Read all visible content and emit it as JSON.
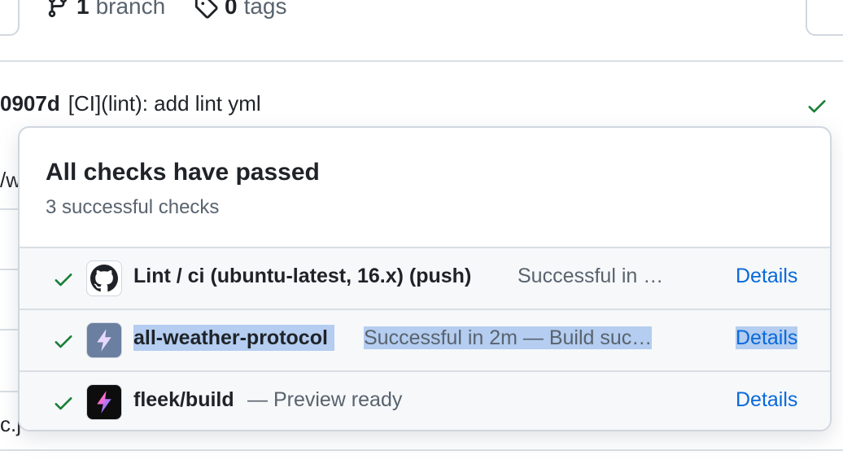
{
  "repo_meta": {
    "branch_count": "1",
    "branch_label": "branch",
    "tag_count": "0",
    "tag_label": "tags"
  },
  "commit": {
    "sha": "0907d",
    "message": "[CI](lint): add lint yml"
  },
  "background_fragments": [
    "/w",
    "c.j"
  ],
  "popover": {
    "title": "All checks have passed",
    "subtitle": "3 successful checks",
    "checks": [
      {
        "name": "Lint / ci (ubuntu-latest, 16.x) (push)",
        "status": "Successful in …",
        "details": "Details",
        "icon": "github-icon"
      },
      {
        "name": "all-weather-protocol",
        "status": "Successful in 2m — Build suc…",
        "details": "Details",
        "icon": "lightning-icon"
      },
      {
        "name": "fleek/build",
        "status": "— Preview ready",
        "details": "Details",
        "icon": "fleek-icon"
      }
    ]
  },
  "colors": {
    "success_green": "#1a7f37",
    "link_blue": "#0969da",
    "selection": "#b4cdf0"
  }
}
